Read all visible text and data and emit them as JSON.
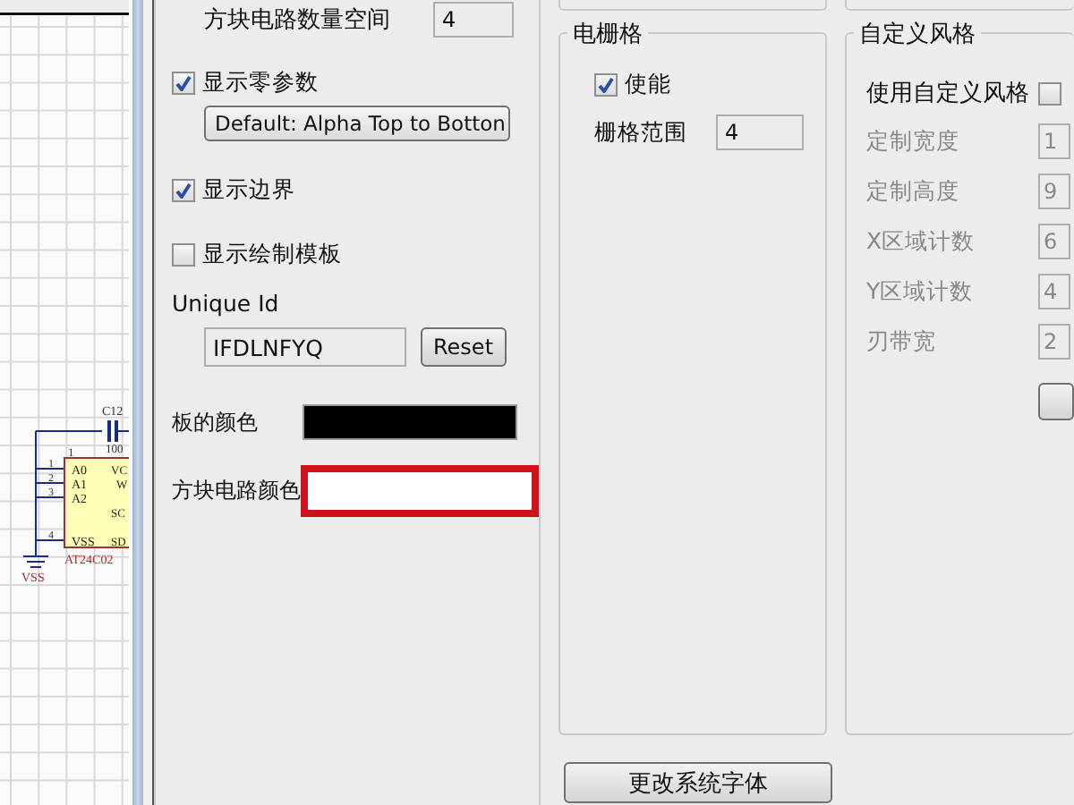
{
  "schematic": {
    "capacitor": {
      "ref": "C12",
      "value": "100"
    },
    "chip": {
      "name": "AT24C02",
      "top_pin": "1",
      "pin_numbers": [
        "1",
        "2",
        "3",
        "4"
      ],
      "left_pins": [
        "A0",
        "A1",
        "A2",
        "VSS"
      ],
      "right_pins": [
        "VC",
        "W",
        "SC",
        "SD"
      ]
    },
    "ground": {
      "label": "VSS"
    }
  },
  "options": {
    "block_space": {
      "label": "方块电路数量空间",
      "value": "4"
    },
    "show_params": {
      "label": "显示零参数",
      "checked": true
    },
    "sort_select": {
      "value": "Default: Alpha Top to Botton"
    },
    "show_border": {
      "label": "显示边界",
      "checked": true
    },
    "show_template": {
      "label": "显示绘制模板",
      "checked": false
    },
    "unique_id": {
      "label": "Unique Id",
      "value": "IFDLNFYQ",
      "button": "Reset"
    },
    "colors": [
      {
        "label": "板的颜色",
        "color": "#000000",
        "highlighted": false
      },
      {
        "label": "方块电路颜色",
        "color": "#ffffff",
        "highlighted": true
      }
    ]
  },
  "electrical_grid": {
    "title": "电栅格",
    "enable": {
      "label": "使能",
      "checked": true
    },
    "range": {
      "label": "栅格范围",
      "value": "4"
    }
  },
  "custom_style": {
    "title": "自定义风格",
    "use": {
      "label": "使用自定义风格",
      "checked": false
    },
    "fields": [
      {
        "label": "定制宽度",
        "value": "1",
        "disabled": true
      },
      {
        "label": "定制高度",
        "value": "9",
        "disabled": true
      },
      {
        "label": "X区域计数",
        "value": "6",
        "disabled": true
      },
      {
        "label": "Y区域计数",
        "value": "4",
        "disabled": true
      },
      {
        "label": "刃带宽",
        "value": "2",
        "disabled": true
      }
    ]
  },
  "font_button": "更改系统字体"
}
